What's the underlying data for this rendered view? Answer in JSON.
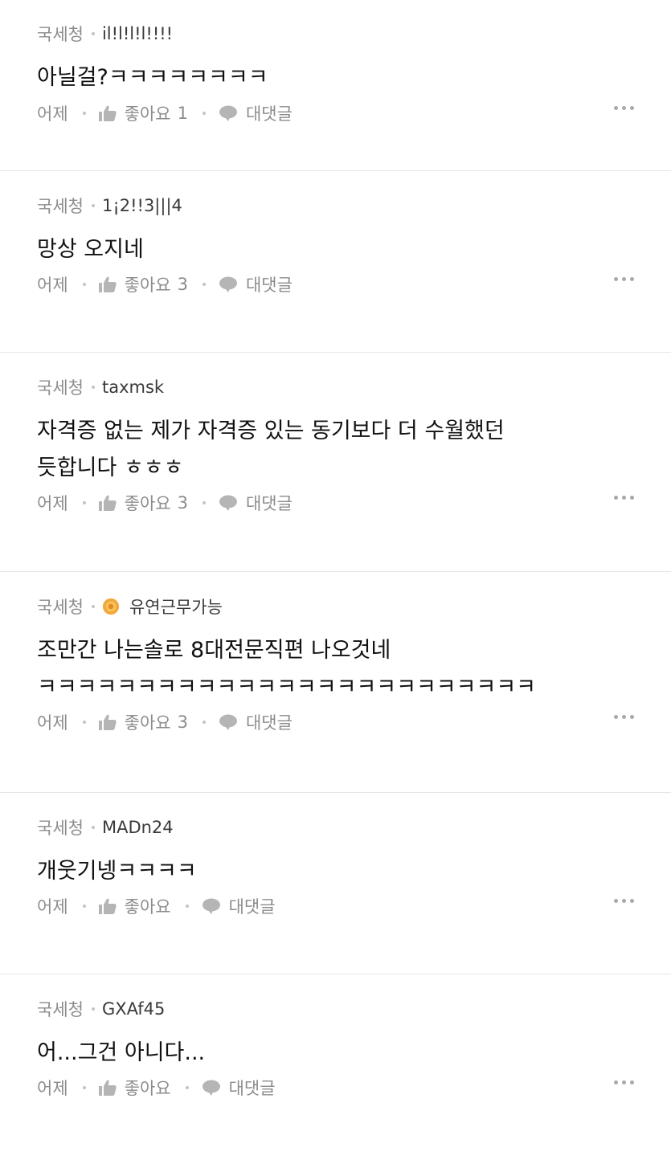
{
  "comments": [
    {
      "department": "국세청",
      "nickname": "il!l!l!l!!!!",
      "text_lines": [
        "아닐걸?ㅋㅋㅋㅋㅋㅋㅋㅋ"
      ],
      "time": "어제",
      "like_label": "좋아요",
      "like_count": "1",
      "reply_label": "대댓글"
    },
    {
      "department": "국세청",
      "nickname": "1¡2!!3|||4",
      "text_lines": [
        "망상 오지네"
      ],
      "time": "어제",
      "like_label": "좋아요",
      "like_count": "3",
      "reply_label": "대댓글"
    },
    {
      "department": "국세청",
      "nickname": "taxmsk",
      "text_lines": [
        "자격증 없는 제가 자격증 있는 동기보다 더 수월했던",
        "듯합니다 ㅎㅎㅎ"
      ],
      "time": "어제",
      "like_label": "좋아요",
      "like_count": "3",
      "reply_label": "대댓글"
    },
    {
      "department": "국세청",
      "nickname": "유연근무가능",
      "badge_icon": "flower-badge-icon",
      "badge_color": "#f2a93b",
      "text_lines": [
        "조만간 나는솔로 8대전문직편 나오것네",
        "ㅋㅋㅋㅋㅋㅋㅋㅋㅋㅋㅋㅋㅋㅋㅋㅋㅋㅋㅋㅋㅋㅋㅋㅋㅋ"
      ],
      "time": "어제",
      "like_label": "좋아요",
      "like_count": "3",
      "reply_label": "대댓글"
    },
    {
      "department": "국세청",
      "nickname": "MADn24",
      "text_lines": [
        "개웃기넹ㅋㅋㅋㅋ"
      ],
      "time": "어제",
      "like_label": "좋아요",
      "like_count": "",
      "reply_label": "대댓글"
    },
    {
      "department": "국세청",
      "nickname": "GXAf45",
      "text_lines": [
        "어...그건 아니다..."
      ],
      "time": "어제",
      "like_label": "좋아요",
      "like_count": "",
      "reply_label": "대댓글"
    }
  ],
  "icons": {
    "like": "thumbs-up-icon",
    "reply": "speech-bubble-icon",
    "more": "more-dots-icon"
  },
  "colors": {
    "meta_text": "#8c8c8c",
    "body_text": "#111111",
    "divider": "#e6e6e6",
    "icon_gray": "#b5b5b5"
  }
}
